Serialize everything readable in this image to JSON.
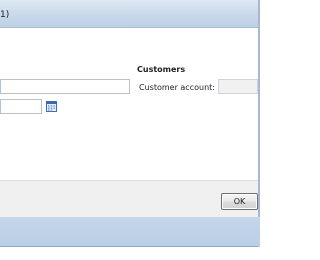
{
  "window": {
    "title_visible": "1)"
  },
  "customers": {
    "heading": "Customers",
    "account_label": "Customer account:",
    "account_value": ""
  },
  "left_fields": {
    "top_value": "",
    "date_value": ""
  },
  "icons": {
    "calendar": "calendar-icon"
  },
  "buttons": {
    "ok_label": "OK"
  }
}
